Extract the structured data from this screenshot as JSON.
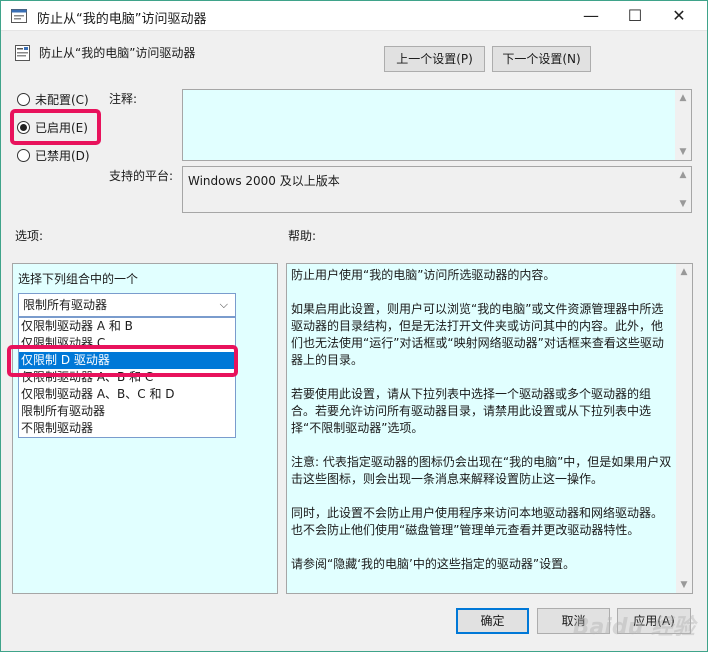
{
  "window": {
    "title": "防止从“我的电脑”访问驱动器",
    "minimize": "—",
    "maximize": "☐",
    "close": "✕"
  },
  "header": {
    "policy_name": "防止从“我的电脑”访问驱动器",
    "prev_setting": "上一个设置(P)",
    "next_setting": "下一个设置(N)"
  },
  "state": {
    "options": [
      "未配置(C)",
      "已启用(E)",
      "已禁用(D)"
    ],
    "selected_index": 1
  },
  "comment": {
    "label": "注释:",
    "value": ""
  },
  "platform": {
    "label": "支持的平台:",
    "value": "Windows 2000 及以上版本"
  },
  "options_section": {
    "label": "选项:",
    "prompt": "选择下列组合中的一个",
    "combo_value": "限制所有驱动器",
    "dropdown_items": [
      "仅限制驱动器 A 和 B",
      "仅限制驱动器 C",
      "仅限制 D 驱动器",
      "仅限制驱动器 A、B 和 C",
      "仅限制驱动器 A、B、C 和 D",
      "限制所有驱动器",
      "不限制驱动器"
    ],
    "dropdown_selected_index": 2
  },
  "help_section": {
    "label": "帮助:",
    "paragraphs": [
      "防止用户使用“我的电脑”访问所选驱动器的内容。",
      "如果启用此设置，则用户可以浏览“我的电脑”或文件资源管理器中所选驱动器的目录结构，但是无法打开文件夹或访问其中的内容。此外，他们也无法使用“运行”对话框或“映射网络驱动器”对话框来查看这些驱动器上的目录。",
      "若要使用此设置，请从下拉列表中选择一个驱动器或多个驱动器的组合。若要允许访问所有驱动器目录，请禁用此设置或从下拉列表中选择“不限制驱动器”选项。",
      "注意: 代表指定驱动器的图标仍会出现在“我的电脑”中，但是如果用户双击这些图标，则会出现一条消息来解释设置防止这一操作。",
      " 同时，此设置不会防止用户使用程序来访问本地驱动器和网络驱动器。也不会防止他们使用“磁盘管理”管理单元查看并更改驱动器特性。",
      "请参阅“隐藏‘我的电脑’中的这些指定的驱动器”设置。"
    ]
  },
  "footer": {
    "ok": "确定",
    "cancel": "取消",
    "apply": "应用(A)"
  },
  "watermark": "Baidu 经验"
}
